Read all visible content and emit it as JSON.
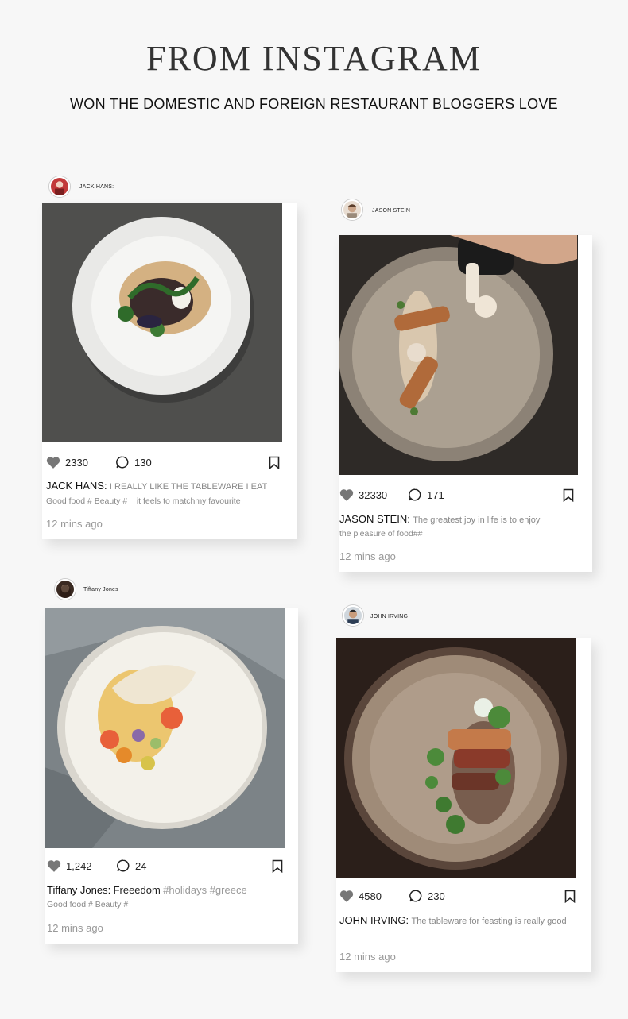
{
  "header": {
    "title": "FROM INSTAGRAM",
    "subtitle": "WON THE DOMESTIC AND FOREIGN RESTAURANT BLOGGERS LOVE"
  },
  "posts": [
    {
      "user": "JACK HANS:",
      "likes": "2330",
      "comments": "130",
      "caption_name": "JACK HANS:",
      "caption_text": "I REALLY LIKE THE TABLEWARE I EAT",
      "tags": "Good food # Beauty #    it feels to matchmy favourite",
      "time": "12 mins ago"
    },
    {
      "user": "JASON STEIN",
      "likes": "32330",
      "comments": "171",
      "caption_name": "JASON STEIN:",
      "caption_text": "The greatest joy in life is to enjoy",
      "tags": "the pleasure of food##",
      "time": "12 mins ago"
    },
    {
      "user": "Tiffany Jones",
      "likes": "1,242",
      "comments": "24",
      "caption_name": "Tiffany Jones:",
      "caption_text": "Freeedom",
      "caption_hashtags": "#holidays #greece",
      "tags": "Good food # Beauty #",
      "time": "12 mins ago"
    },
    {
      "user": "JOHN IRVING",
      "likes": "4580",
      "comments": "230",
      "caption_name": "JOHN IRVING:",
      "caption_text": "The tableware for feasting is really good",
      "time": "12 mins ago"
    }
  ],
  "colors": {
    "icon": "#777777",
    "card": "#ffffff",
    "background": "#f7f7f7"
  }
}
